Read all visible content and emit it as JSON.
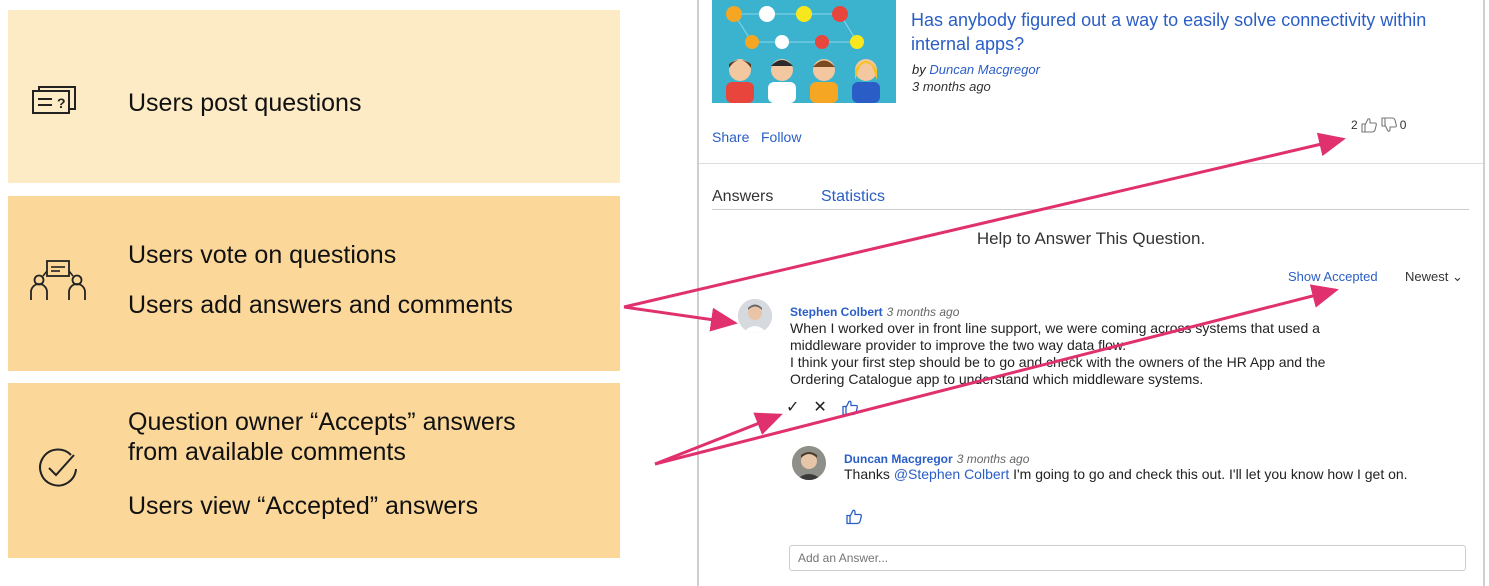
{
  "features": [
    {
      "icon": "question-cards-icon",
      "lines": [
        "Users post questions"
      ]
    },
    {
      "icon": "users-discussion-icon",
      "lines": [
        "Users vote on questions",
        "Users add answers and comments"
      ]
    },
    {
      "icon": "check-circle-icon",
      "lines": [
        "Question owner “Accepts” answers",
        "from available comments",
        "Users view “Accepted” answers"
      ]
    }
  ],
  "question": {
    "title": "Has anybody figured out a way to easily solve connectivity within internal apps?",
    "by_prefix": "by ",
    "author": "Duncan Macgregor",
    "ago": "3 months ago",
    "share_label": "Share",
    "follow_label": "Follow",
    "upvotes": "2",
    "downvotes": "0"
  },
  "tabs": {
    "answers": "Answers",
    "statistics": "Statistics"
  },
  "help_text": "Help to Answer This Question.",
  "filter": {
    "show_accepted": "Show Accepted",
    "sort": "Newest"
  },
  "comments": [
    {
      "author": "Stephen Colbert",
      "ago": "3 months ago",
      "body": [
        "When I worked over in front line support, we were coming across systems that used a",
        "middleware provider to improve the two way data flow.",
        "I think your first step should be to go and check with the owners of the HR App and the",
        "Ordering Catalogue app to understand which middleware systems."
      ],
      "accept_glyph": "✓",
      "reject_glyph": "✕"
    },
    {
      "author": "Duncan Macgregor",
      "ago": "3 months ago",
      "body_pre": "Thanks ",
      "mention": "@Stephen Colbert",
      "body_post": " I'm going to go and check this out. I'll let you know how I get on."
    }
  ],
  "answer_input": {
    "placeholder": "Add an Answer..."
  },
  "colors": {
    "arrow": "#e0306e",
    "link": "#2a5ec6",
    "box_light": "#fdebc6",
    "box_dark": "#fbd89a"
  }
}
